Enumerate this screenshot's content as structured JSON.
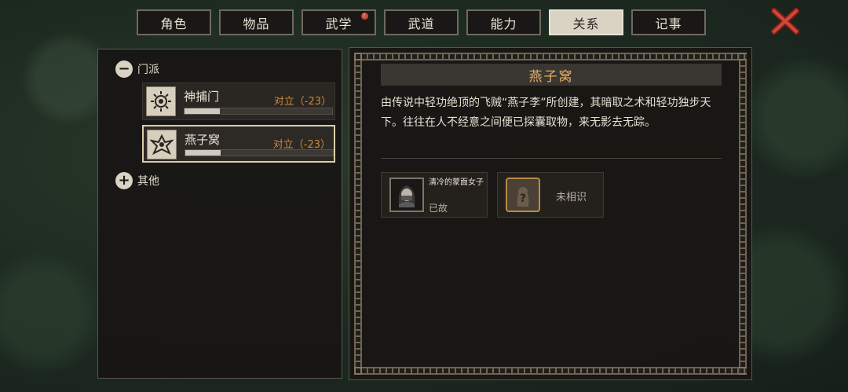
{
  "tabs": [
    {
      "label": "角色",
      "active": false,
      "badge": false
    },
    {
      "label": "物品",
      "active": false,
      "badge": false
    },
    {
      "label": "武学",
      "active": false,
      "badge": true
    },
    {
      "label": "武道",
      "active": false,
      "badge": false
    },
    {
      "label": "能力",
      "active": false,
      "badge": false
    },
    {
      "label": "关系",
      "active": true,
      "badge": false
    },
    {
      "label": "记事",
      "active": false,
      "badge": false
    }
  ],
  "badge_glyph": "!",
  "colors": {
    "accent_title": "#e8b065",
    "hostile_status": "#d08a3e",
    "close_red": "#c0392b"
  },
  "sidebar": {
    "groups": [
      {
        "label": "门派",
        "expanded": true,
        "icon": "minus-icon"
      },
      {
        "label": "其他",
        "expanded": false,
        "icon": "plus-icon"
      }
    ],
    "factions": [
      {
        "name": "神捕门",
        "status": "对立（-23）",
        "relation_progress": 0.24,
        "emblem": "sun-emblem-icon",
        "selected": false
      },
      {
        "name": "燕子窝",
        "status": "对立（-23）",
        "relation_progress": 0.24,
        "emblem": "swallow-emblem-icon",
        "selected": true
      }
    ]
  },
  "detail": {
    "title": "燕子窝",
    "description": "由传说中轻功绝顶的飞贼“燕子李”所创建，其暗取之术和轻功独步天下。往往在人不经意之间便已探囊取物，来无影去无踪。",
    "members": [
      {
        "name": "清冷的蒙面女子",
        "status": "已故",
        "portrait": "masked-woman-portrait-icon"
      },
      {
        "name": "",
        "status": "未相识",
        "portrait": "unknown-question-icon"
      }
    ]
  }
}
